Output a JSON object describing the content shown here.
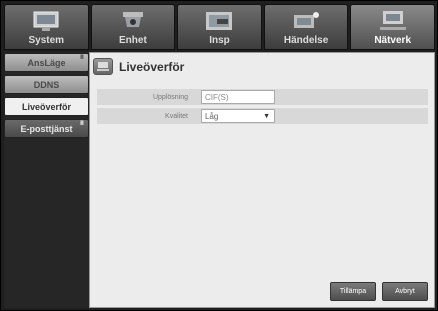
{
  "top_tabs": [
    {
      "label": "System",
      "icon": "monitor-icon"
    },
    {
      "label": "Enhet",
      "icon": "camera-icon"
    },
    {
      "label": "Insp",
      "icon": "record-icon"
    },
    {
      "label": "Händelse",
      "icon": "event-icon"
    },
    {
      "label": "Nätverk",
      "icon": "network-icon"
    }
  ],
  "sidebar": {
    "items": [
      {
        "label": "AnsLäge"
      },
      {
        "label": "DDNS"
      },
      {
        "label": "Liveöverför"
      },
      {
        "label": "E-posttjänst"
      }
    ]
  },
  "panel": {
    "title": "Liveöverför",
    "resolution_label": "Upplösning",
    "resolution_value": "CIF(S)",
    "quality_label": "Kvalitet",
    "quality_value": "Låg"
  },
  "buttons": {
    "apply": "Tillämpa",
    "cancel": "Avbryt"
  },
  "colors": {
    "active_tab": "#505050",
    "panel_bg": "#ececec",
    "row_bg": "#d8d8d8"
  }
}
